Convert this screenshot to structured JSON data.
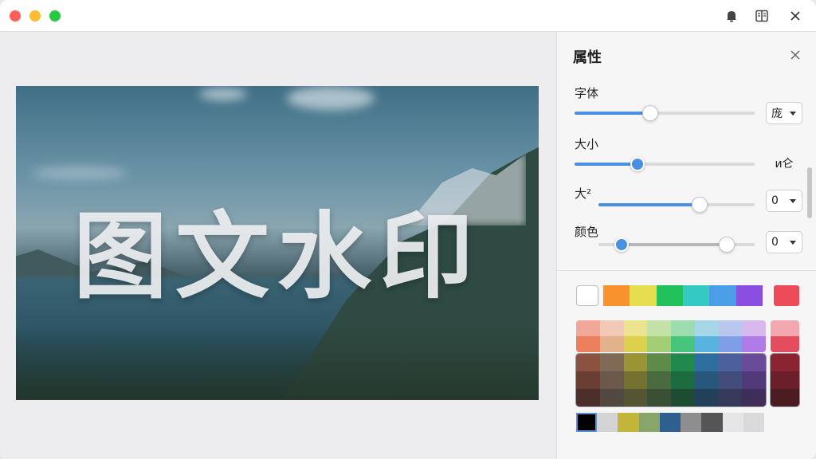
{
  "titlebar": {
    "icons": [
      "bell-icon",
      "panel-layout-icon",
      "close-icon"
    ]
  },
  "canvas": {
    "watermark_text": "图文水印"
  },
  "panel": {
    "title": "属性",
    "rows": [
      {
        "label": "字体",
        "control": "select",
        "value": "庞",
        "slider_value": 0.42
      },
      {
        "label": "大小",
        "control": "value",
        "value": "ᴎ仑",
        "slider_value": 0.35
      },
      {
        "label": "大²",
        "control": "select",
        "value": "0",
        "slider_value": 0.65
      },
      {
        "label": "颜色",
        "control": "select",
        "value": "0",
        "range_low": 0.15,
        "range_high": 0.82
      }
    ]
  },
  "palette": {
    "primary_strip": [
      "#f7922d",
      "#e6dd4f",
      "#23c15b",
      "#34c9c2",
      "#4a9de6",
      "#8a4fe0"
    ],
    "accent_red": "#ee4b5a",
    "light_grid": [
      [
        "#f2a898",
        "#f2c8b6",
        "#ece38e",
        "#c5e2a6",
        "#9ddcae",
        "#a7d6e8",
        "#b9c6ee",
        "#d8b9ee"
      ],
      [
        "#ec7f5c",
        "#e2b28a",
        "#ddd04a",
        "#a4ce73",
        "#46c47a",
        "#58b3de",
        "#7f9ee6",
        "#b07be6"
      ]
    ],
    "dark_grid": [
      [
        "#8b5240",
        "#7f6a55",
        "#9b9434",
        "#5f8a4a",
        "#1f8a4c",
        "#2d6e9e",
        "#4e5f9e",
        "#6a4b9a"
      ],
      [
        "#6b3e33",
        "#6b5a4b",
        "#757130",
        "#4a6b3f",
        "#1b6b3f",
        "#27577b",
        "#434d7b",
        "#52397a"
      ],
      [
        "#4c2f2a",
        "#524842",
        "#555433",
        "#3a4f34",
        "#1d4c33",
        "#23405a",
        "#37395a",
        "#3f2e59"
      ]
    ],
    "side_light": [
      "#f2a8ae",
      "#e34b5e"
    ],
    "side_dark": [
      "#8a2431",
      "#6b1f2b",
      "#4b1b22"
    ],
    "gray_row": [
      "#000000",
      "#d4d4d6",
      "#c2b53a",
      "#88a66a",
      "#2f5f8e",
      "#8e8e90",
      "#555557",
      "#e6e6e8",
      "#dadadc"
    ]
  }
}
